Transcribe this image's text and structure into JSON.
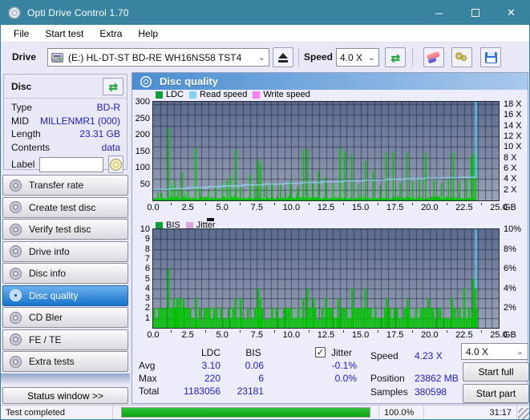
{
  "window": {
    "title": "Opti Drive Control 1.70"
  },
  "menu": {
    "items": [
      "File",
      "Start test",
      "Extra",
      "Help"
    ]
  },
  "toolbar": {
    "drive_label": "Drive",
    "drive_value": "(E:)  HL-DT-ST BD-RE  WH16NS58 TST4",
    "speed_label": "Speed",
    "speed_value": "4.0 X"
  },
  "disc_panel": {
    "title": "Disc",
    "rows": [
      {
        "label": "Type",
        "value": "BD-R"
      },
      {
        "label": "MID",
        "value": "MILLENMR1 (000)"
      },
      {
        "label": "Length",
        "value": "23.31 GB"
      },
      {
        "label": "Contents",
        "value": "data"
      }
    ],
    "label_caption": "Label",
    "label_value": ""
  },
  "sidebar": {
    "items": [
      {
        "label": "Transfer rate",
        "slug": "transfer-rate",
        "active": false
      },
      {
        "label": "Create test disc",
        "slug": "create-test-disc",
        "active": false
      },
      {
        "label": "Verify test disc",
        "slug": "verify-test-disc",
        "active": false
      },
      {
        "label": "Drive info",
        "slug": "drive-info",
        "active": false
      },
      {
        "label": "Disc info",
        "slug": "disc-info",
        "active": false
      },
      {
        "label": "Disc quality",
        "slug": "disc-quality",
        "active": true
      },
      {
        "label": "CD Bler",
        "slug": "cd-bler",
        "active": false
      },
      {
        "label": "FE / TE",
        "slug": "fe-te",
        "active": false
      },
      {
        "label": "Extra tests",
        "slug": "extra-tests",
        "active": false
      }
    ],
    "status_window": "Status window >>"
  },
  "panel": {
    "title": "Disc quality"
  },
  "stats": {
    "col_headers": [
      "LDC",
      "BIS"
    ],
    "jitter_label": "Jitter",
    "jitter_checked": true,
    "rows": [
      {
        "label": "Avg",
        "ldc": "3.10",
        "bis": "0.06",
        "jitter": "-0.1%"
      },
      {
        "label": "Max",
        "ldc": "220",
        "bis": "6",
        "jitter": "0.0%"
      },
      {
        "label": "Total",
        "ldc": "1183056",
        "bis": "23181",
        "jitter": ""
      }
    ],
    "speed_label": "Speed",
    "speed_value": "4.23 X",
    "position_label": "Position",
    "position_value": "23862 MB",
    "samples_label": "Samples",
    "samples_value": "380598",
    "speed_select": "4.0 X",
    "start_full": "Start full",
    "start_part": "Start part"
  },
  "statusbar": {
    "status": "Test completed",
    "progress_pct": "100.0%",
    "progress_value": 100,
    "time": "31:17"
  },
  "colors": {
    "titlebar": "#38839f",
    "value_blue": "#2121cc",
    "bar_green": "#00c400",
    "read_line": "#8ed6f6",
    "end_line": "#4fd2fc",
    "plot_top": "#5c6b8f",
    "plot_bottom": "#9aa3b8",
    "grid": "rgba(28,32,48,0.55)",
    "progress_green": "#0aa312",
    "header_blue_left": "#4a8ed2",
    "header_blue_right": "#a9c8ec"
  },
  "chart_data": [
    {
      "type": "bar",
      "title": "LDC errors and read speed vs position",
      "x_unit": "GB",
      "x_range": [
        0,
        25
      ],
      "data_end_gb": 23.35,
      "x_ticks": [
        "0.0",
        "2.5",
        "5.0",
        "7.5",
        "10.0",
        "12.5",
        "15.0",
        "17.5",
        "20.0",
        "22.5",
        "25.0"
      ],
      "y_left_ticks": [
        "300",
        "250",
        "200",
        "150",
        "100",
        "50"
      ],
      "y_left_range": [
        0,
        300
      ],
      "y_right_ticks": [
        "18 X",
        "16 X",
        "14 X",
        "12 X",
        "10 X",
        "8 X",
        "6 X",
        "4 X",
        "2 X"
      ],
      "y_right_max": 18.45,
      "legend": [
        {
          "label": "LDC",
          "color": "#0aa334"
        },
        {
          "label": "Read speed",
          "color": "#7fd2f2"
        },
        {
          "label": "Write speed",
          "color": "#f57ff5"
        }
      ],
      "baseline": {
        "min": 4,
        "max": 16
      },
      "ldc_spikes": [
        [
          0.35,
          25
        ],
        [
          0.6,
          22
        ],
        [
          1.1,
          220
        ],
        [
          1.35,
          45
        ],
        [
          1.55,
          60
        ],
        [
          1.8,
          35
        ],
        [
          2.1,
          85
        ],
        [
          2.5,
          30
        ],
        [
          3.05,
          160
        ],
        [
          3.35,
          40
        ],
        [
          4.0,
          30
        ],
        [
          4.5,
          40
        ],
        [
          5.0,
          50
        ],
        [
          5.35,
          60
        ],
        [
          5.55,
          75
        ],
        [
          5.95,
          155
        ],
        [
          6.3,
          45
        ],
        [
          7.0,
          80
        ],
        [
          7.35,
          50
        ],
        [
          7.6,
          125
        ],
        [
          7.75,
          110
        ],
        [
          8.2,
          45
        ],
        [
          8.6,
          55
        ],
        [
          9.2,
          50
        ],
        [
          9.9,
          60
        ],
        [
          10.45,
          40
        ],
        [
          10.85,
          155
        ],
        [
          11.15,
          155
        ],
        [
          11.55,
          55
        ],
        [
          11.95,
          90
        ],
        [
          12.45,
          70
        ],
        [
          13.0,
          50
        ],
        [
          13.5,
          160
        ],
        [
          13.85,
          150
        ],
        [
          14.35,
          140
        ],
        [
          14.85,
          50
        ],
        [
          15.35,
          120
        ],
        [
          15.9,
          90
        ],
        [
          16.4,
          45
        ],
        [
          16.85,
          145
        ],
        [
          17.35,
          150
        ],
        [
          17.85,
          55
        ],
        [
          18.35,
          145
        ],
        [
          18.75,
          60
        ],
        [
          19.25,
          65
        ],
        [
          19.7,
          145
        ],
        [
          20.3,
          60
        ],
        [
          20.85,
          55
        ],
        [
          21.35,
          65
        ],
        [
          21.7,
          145
        ],
        [
          22.15,
          60
        ],
        [
          22.65,
          65
        ],
        [
          23.0,
          130
        ],
        [
          23.15,
          145
        ],
        [
          23.3,
          135
        ]
      ],
      "read_speed_steps": [
        [
          0,
          2.05
        ],
        [
          1.2,
          2.2
        ],
        [
          2.5,
          2.4
        ],
        [
          4,
          2.55
        ],
        [
          5,
          2.7
        ],
        [
          6.5,
          2.9
        ],
        [
          8,
          3.05
        ],
        [
          9.5,
          3.2
        ],
        [
          10.8,
          3.35
        ],
        [
          12.2,
          3.5
        ],
        [
          13.8,
          3.65
        ],
        [
          15.2,
          3.8
        ],
        [
          16.8,
          3.95
        ],
        [
          18.2,
          4.05
        ],
        [
          19.6,
          4.15
        ],
        [
          21,
          4.25
        ],
        [
          22.2,
          4.32
        ],
        [
          23.3,
          4.38
        ]
      ],
      "end_spike": {
        "x_gb": 23.35,
        "from_x": 4.38,
        "to_x": 18.4
      }
    },
    {
      "type": "bar",
      "title": "BIS errors and jitter vs position",
      "x_unit": "GB",
      "x_range": [
        0,
        25
      ],
      "data_end_gb": 23.35,
      "x_ticks": [
        "0.0",
        "2.5",
        "5.0",
        "7.5",
        "10.0",
        "12.5",
        "15.0",
        "17.5",
        "20.0",
        "22.5",
        "25.0"
      ],
      "y_left_ticks": [
        "10",
        "9",
        "8",
        "7",
        "6",
        "5",
        "4",
        "3",
        "2",
        "1"
      ],
      "y_left_range": [
        0,
        10
      ],
      "y_right_ticks": [
        "10%",
        "8%",
        "6%",
        "4%",
        "2%"
      ],
      "y_right_max": 10,
      "legend": [
        {
          "label": "BIS",
          "color": "#0aa334"
        },
        {
          "label": "Jitter",
          "color": "#d9a7d9"
        }
      ],
      "baseline": {
        "base": 1,
        "extra_prob": 0.62
      },
      "bis_spikes": [
        [
          1.1,
          6
        ],
        [
          1.5,
          3
        ],
        [
          1.75,
          3
        ],
        [
          1.95,
          3
        ],
        [
          2.2,
          3
        ],
        [
          3.1,
          3
        ],
        [
          5.95,
          3
        ],
        [
          6.35,
          3
        ],
        [
          7.6,
          4
        ],
        [
          7.75,
          3
        ],
        [
          10.85,
          3
        ],
        [
          11.15,
          4
        ],
        [
          11.6,
          3
        ],
        [
          12.5,
          3
        ],
        [
          13.4,
          3
        ],
        [
          14.4,
          4
        ],
        [
          15.35,
          4
        ],
        [
          16.9,
          3
        ],
        [
          18.4,
          3
        ],
        [
          19.9,
          3
        ],
        [
          21.6,
          3
        ],
        [
          22.5,
          4
        ],
        [
          23.15,
          5
        ],
        [
          23.3,
          4
        ]
      ],
      "end_line": {
        "x_gb": 23.35,
        "from": 10,
        "to": 4
      }
    }
  ]
}
